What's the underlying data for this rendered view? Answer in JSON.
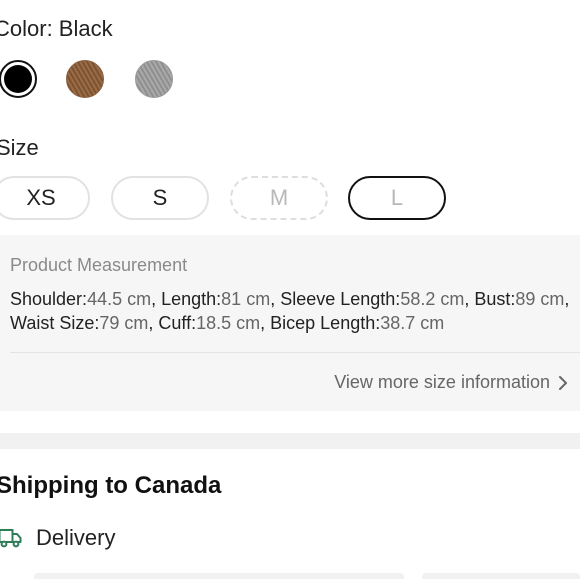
{
  "color": {
    "label": "Color: Black",
    "swatches": [
      {
        "name": "Black",
        "color": "#000000",
        "selected": true
      },
      {
        "name": "Brown",
        "color": "#8a5d3a",
        "selected": false
      },
      {
        "name": "Grey",
        "color": "#9d9d9d",
        "selected": false
      }
    ]
  },
  "size": {
    "label": "Size",
    "options": [
      {
        "label": "XS",
        "state": "available"
      },
      {
        "label": "S",
        "state": "available"
      },
      {
        "label": "M",
        "state": "unavailable"
      },
      {
        "label": "L",
        "state": "selected-unavailable"
      }
    ]
  },
  "measurement": {
    "title": "Product Measurement",
    "items": [
      {
        "key": "Shoulder:",
        "value": "44.5 cm",
        "sep": ", "
      },
      {
        "key": "Length:",
        "value": "81 cm",
        "sep": ", "
      },
      {
        "key": "Sleeve Length:",
        "value": "58.2 cm",
        "sep": ", "
      },
      {
        "key": "Bust:",
        "value": "89 cm",
        "sep": ", "
      },
      {
        "key": "Waist Size:",
        "value": "79 cm",
        "sep": ", "
      },
      {
        "key": "Cuff:",
        "value": "18.5 cm",
        "sep": ", "
      },
      {
        "key": "Bicep Length:",
        "value": "38.7 cm",
        "sep": ""
      }
    ],
    "more_link": "View more size information"
  },
  "shipping": {
    "title": "Shipping to Canada",
    "delivery_label": "Delivery",
    "accent": "#2f7d57"
  }
}
